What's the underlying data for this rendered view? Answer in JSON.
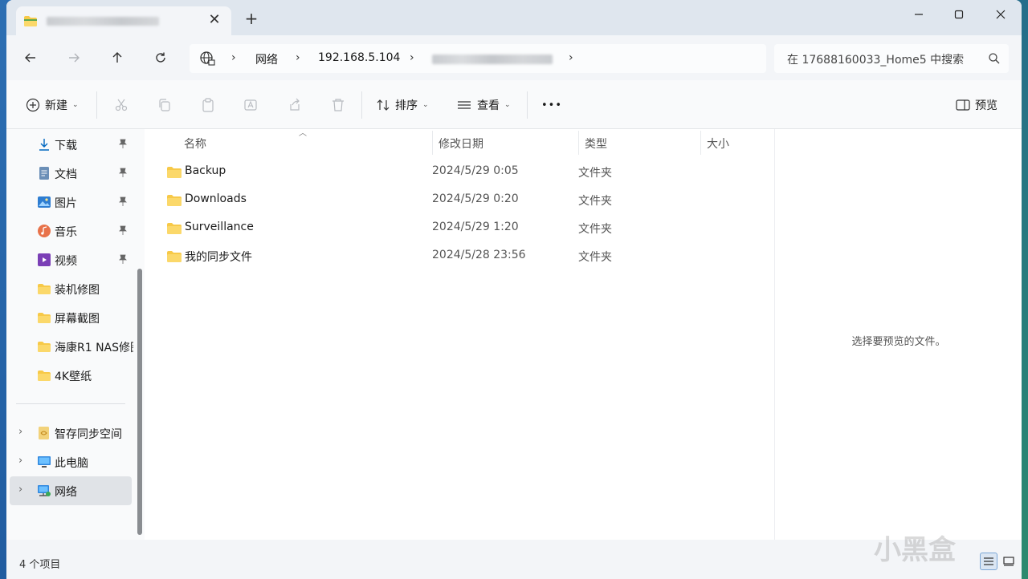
{
  "window": {
    "tab_close_glyph": "✕",
    "new_tab_glyph": "+",
    "controls": {
      "minimize": "—",
      "maximize": "☐",
      "close": "✕"
    }
  },
  "address": {
    "separator": "›",
    "crumbs": [
      "网络",
      "192.168.5.104"
    ],
    "search_placeholder": "在 17688160033_Home5 中搜索"
  },
  "toolbar": {
    "new_label": "新建",
    "sort_label": "排序",
    "view_label": "查看",
    "more_label": "•••",
    "preview_label": "预览"
  },
  "sidebar": {
    "pinned": [
      {
        "label": "下载",
        "icon": "download-icon"
      },
      {
        "label": "文档",
        "icon": "document-icon"
      },
      {
        "label": "图片",
        "icon": "pictures-icon"
      },
      {
        "label": "音乐",
        "icon": "music-icon"
      },
      {
        "label": "视频",
        "icon": "video-icon"
      }
    ],
    "folders": [
      "装机修图",
      "屏幕截图",
      "海康R1 NAS修图",
      "4K壁纸"
    ],
    "roots": [
      {
        "label": "智存同步空间",
        "icon": "sync-space-icon"
      },
      {
        "label": "此电脑",
        "icon": "this-pc-icon"
      },
      {
        "label": "网络",
        "icon": "network-icon",
        "selected": true
      }
    ],
    "pin_glyph": "📌",
    "expander_glyph": "›"
  },
  "columns": {
    "name": "名称",
    "date": "修改日期",
    "type": "类型",
    "size": "大小"
  },
  "files": [
    {
      "name": "Backup",
      "date": "2024/5/29 0:05",
      "type": "文件夹"
    },
    {
      "name": "Downloads",
      "date": "2024/5/29 0:20",
      "type": "文件夹"
    },
    {
      "name": "Surveillance",
      "date": "2024/5/29 1:20",
      "type": "文件夹"
    },
    {
      "name": "我的同步文件",
      "date": "2024/5/28 23:56",
      "type": "文件夹"
    }
  ],
  "preview": {
    "empty_text": "选择要预览的文件。"
  },
  "status": {
    "item_count": "4 个项目"
  },
  "watermark": "小黑盒",
  "colors": {
    "folder": "#f7c948",
    "accent": "#0067c0",
    "selected_bg": "#e0e3e7"
  }
}
